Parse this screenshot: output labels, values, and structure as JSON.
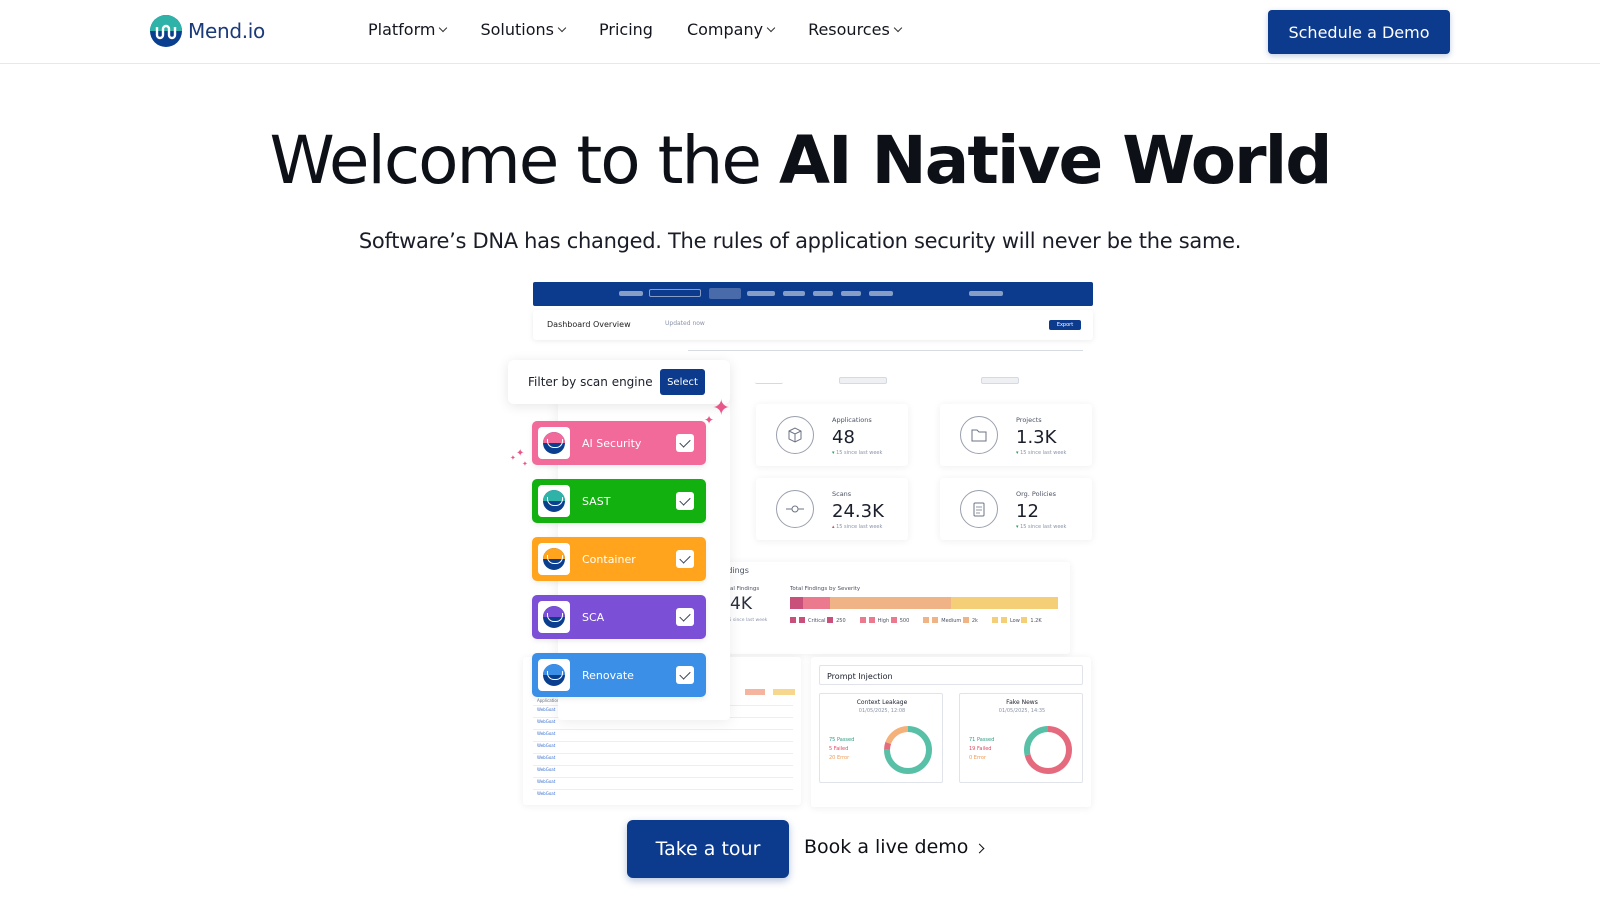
{
  "nav": {
    "logo_text": "Mend.io",
    "links": [
      {
        "label": "Platform",
        "has_dropdown": true
      },
      {
        "label": "Solutions",
        "has_dropdown": true
      },
      {
        "label": "Pricing",
        "has_dropdown": false
      },
      {
        "label": "Company",
        "has_dropdown": true
      },
      {
        "label": "Resources",
        "has_dropdown": true
      }
    ],
    "cta_label": "Schedule a Demo"
  },
  "hero": {
    "title_regular": "Welcome to the ",
    "title_bold": "AI Native World",
    "subtitle": "Software’s DNA has changed. The rules of application security will never be the same."
  },
  "dashboard": {
    "overview_title": "Dashboard Overview",
    "updated_text": "Updated now",
    "export_label": "Export",
    "stats": [
      {
        "label": "Applications",
        "value": "48",
        "delta": "15 since last week"
      },
      {
        "label": "Projects",
        "value": "1.3K",
        "delta": "15 since last week"
      },
      {
        "label": "Scans",
        "value": "24.3K",
        "delta": "15 since last week"
      },
      {
        "label": "Org. Policies",
        "value": "12",
        "delta": "15 since last week"
      }
    ],
    "findings": {
      "title": "Findings",
      "total_label": "Total Findings",
      "total_value": "4K",
      "total_delta": "15 since last week",
      "severity_label": "Total Findings by Severity",
      "severity": [
        {
          "name": "Critical",
          "value": "250",
          "color": "#c9507a"
        },
        {
          "name": "High",
          "value": "500",
          "color": "#ec7a8e"
        },
        {
          "name": "Medium",
          "value": "2k",
          "color": "#f0b386"
        },
        {
          "name": "Low",
          "value": "1.2K",
          "color": "#f5cf78"
        }
      ]
    },
    "prompt_injection": {
      "title": "Prompt Injection",
      "cards": [
        {
          "name": "Context Leakage",
          "date": "01/05/2025, 12:08",
          "passed": "75",
          "failed": "5",
          "error": "20",
          "ring_color": "#58c0a6"
        },
        {
          "name": "Fake News",
          "date": "01/05/2025, 14:35",
          "passed": "71",
          "failed": "19",
          "error": "0",
          "ring_color": "#e66a7d"
        }
      ],
      "passed_label": "Passed",
      "failed_label": "Failed",
      "error_label": "Error"
    },
    "table_header": "Application",
    "table_row_label": "WebGoat"
  },
  "filter": {
    "label": "Filter by scan engine",
    "select_label": "Select",
    "engines": [
      {
        "label": "AI Security",
        "color": "#f16a9a",
        "ring": "#f16a9a"
      },
      {
        "label": "SAST",
        "color": "#13b10f",
        "ring": "#2fb3a8"
      },
      {
        "label": "Container",
        "color": "#ffa41c",
        "ring": "#ffa41c"
      },
      {
        "label": "SCA",
        "color": "#7b4fd6",
        "ring": "#7b4fd6"
      },
      {
        "label": "Renovate",
        "color": "#3b8fe6",
        "ring": "#3b8fe6"
      }
    ]
  },
  "ctas": {
    "tour_label": "Take a tour",
    "live_demo_label": "Book a live demo"
  },
  "colors": {
    "brand_navy": "#0c3a8c",
    "brand_teal": "#2fb3a8"
  }
}
